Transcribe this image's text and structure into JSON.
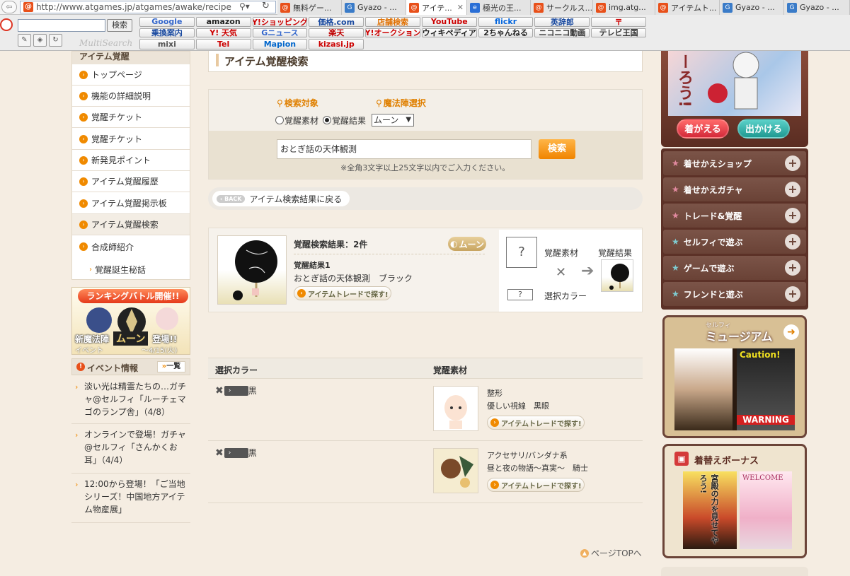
{
  "browser": {
    "url": "http://www.atgames.jp/atgames/awake/recipe",
    "tabs": [
      {
        "label": "無料ゲー...",
        "icon": "at",
        "color": "#e8501a"
      },
      {
        "label": "Gyazo - ...",
        "icon": "gyazo",
        "color": "#3a7bc8"
      },
      {
        "label": "アイテ...",
        "icon": "at",
        "color": "#e8501a",
        "active": true
      },
      {
        "label": "極光の王...",
        "icon": "ie",
        "color": "#2a6fd6"
      },
      {
        "label": "サークルス...",
        "icon": "at",
        "color": "#e8501a"
      },
      {
        "label": "img.atg...",
        "icon": "at",
        "color": "#e8501a"
      },
      {
        "label": "アイテムト...",
        "icon": "at",
        "color": "#e8501a"
      },
      {
        "label": "Gyazo - ...",
        "icon": "gyazo",
        "color": "#3a7bc8"
      },
      {
        "label": "Gyazo - ...",
        "icon": "gyazo",
        "color": "#3a7bc8"
      }
    ],
    "multisearch_button": "検索",
    "multisearch_label": "MultiSearch",
    "bookmarks": [
      {
        "label": "Google",
        "color": "#3366cc"
      },
      {
        "label": "amazon",
        "color": "#222222"
      },
      {
        "label": "Y!ショッピング",
        "color": "#cc0000"
      },
      {
        "label": "価格.com",
        "color": "#1a4aa0"
      },
      {
        "label": "店舗検索",
        "color": "#e07000"
      },
      {
        "label": "YouTube",
        "color": "#cc0000"
      },
      {
        "label": "flickr",
        "color": "#0063dc"
      },
      {
        "label": "英辞郎",
        "color": "#1a4aa0"
      },
      {
        "label": "〒",
        "color": "#cc0000"
      },
      {
        "label": "乗換案内",
        "color": "#1a4aa0"
      },
      {
        "label": "Y! 天気",
        "color": "#cc0000"
      },
      {
        "label": "Gニュース",
        "color": "#3366cc"
      },
      {
        "label": "楽天",
        "color": "#bf0000"
      },
      {
        "label": "Y!オークション",
        "color": "#cc0000"
      },
      {
        "label": "ウィキペディア",
        "color": "#222222"
      },
      {
        "label": "2ちゃんねる",
        "color": "#222222"
      },
      {
        "label": "ニコニコ動画",
        "color": "#333333"
      },
      {
        "label": "テレビ王国",
        "color": "#333333"
      },
      {
        "label": "mixi",
        "color": "#555555"
      },
      {
        "label": "Tel",
        "color": "#cc0000"
      },
      {
        "label": "Mapion",
        "color": "#0066cc"
      },
      {
        "label": "kizasi.jp",
        "color": "#cc0000"
      }
    ]
  },
  "sidebar": {
    "heading": "アイテム覚醒",
    "items": [
      {
        "label": "トップページ"
      },
      {
        "label": "機能の詳細説明"
      },
      {
        "label": "覚醒チケット"
      },
      {
        "label": "覚醒チケット"
      },
      {
        "label": "新発見ポイント"
      },
      {
        "label": "アイテム覚醒履歴"
      },
      {
        "label": "アイテム覚醒掲示板"
      },
      {
        "label": "アイテム覚醒検索",
        "selected": true
      },
      {
        "label": "合成師紹介"
      }
    ],
    "sub_item": "覚醒誕生秘話"
  },
  "event_banner": {
    "title": "ランキングバトル開催!!",
    "line1": "新魔法陣",
    "highlight": "ムーン",
    "line1_suffix": "登場!!",
    "tag": "イベント",
    "period": "〜4/15(火)"
  },
  "event_info": {
    "heading": "イベント情報",
    "more": "一覧",
    "items": [
      "淡い光は精霊たちの…ガチャ@セルフィ「ルーチェマゴのランプ舎」（4/8）",
      "オンラインで登場！ガチャ@セルフィ「さんかくお耳」（4/4）",
      "12:00から登場！「ご当地シリーズ！中国地方アイテム物産展」"
    ]
  },
  "main": {
    "title": "アイテム覚醒検索",
    "search": {
      "target_label": "検索対象",
      "circle_label": "魔法陣選択",
      "radio_material": "覚醒素材",
      "radio_result": "覚醒結果",
      "selected_radio": "result",
      "select_value": "ムーン",
      "keyword": "おとぎ話の天体観測",
      "button": "検索",
      "note": "※全角3文字以上25文字以内でご入力ください。"
    },
    "back_pill": "BACK",
    "back_label": "アイテム検索結果に戻る",
    "result": {
      "count_label": "覚醒検索結果：2件",
      "badge": "ムーン",
      "item_label": "覚醒結果1",
      "item_name": "おとぎ話の天体観測　ブラック",
      "trade_button": "アイテムトレードで探す!",
      "material_label": "覚醒素材",
      "result_label": "覚醒結果",
      "color_label": "選択カラー",
      "qmark": "?"
    },
    "table": {
      "col_color": "選択カラー",
      "col_material": "覚醒素材",
      "rows": [
        {
          "color_text": "黒",
          "material_type": "整形",
          "material_name": "優しい視線　黒眼",
          "trade_button": "アイテムトレードで探す!"
        },
        {
          "color_text": "黒",
          "material_type": "アクセサリ/バンダナ系",
          "material_name": "昼と夜の物語〜真実〜　騎士",
          "trade_button": "アイテムトレードで探す!"
        }
      ]
    },
    "page_top": "ページTOPへ"
  },
  "right": {
    "top_text": "ーろう!",
    "btn_dress": "着がえる",
    "btn_go": "出かける",
    "menu": [
      {
        "label": "着せかえショップ",
        "star": "#e28aa0"
      },
      {
        "label": "着せかえガチャ",
        "star": "#e28aa0"
      },
      {
        "label": "トレード&覚醒",
        "star": "#e28aa0"
      },
      {
        "label": "セルフィで遊ぶ",
        "star": "#7ecbd0"
      },
      {
        "label": "ゲームで遊ぶ",
        "star": "#7ecbd0"
      },
      {
        "label": "フレンドと遊ぶ",
        "star": "#7ecbd0"
      }
    ],
    "museum_small": "セルフィ",
    "museum_title": "ミュージアム",
    "museum_caution": "Caution!",
    "museum_warning": "WARNING",
    "bonus_title": "着替えボーナス",
    "bonus_text": "宮殿の力を見せてやろう!",
    "bonus_welcome": "WELCOME"
  },
  "colors": {
    "accent": "#f08a00",
    "brown": "#5c3127",
    "page_bg": "#f5ede2"
  }
}
